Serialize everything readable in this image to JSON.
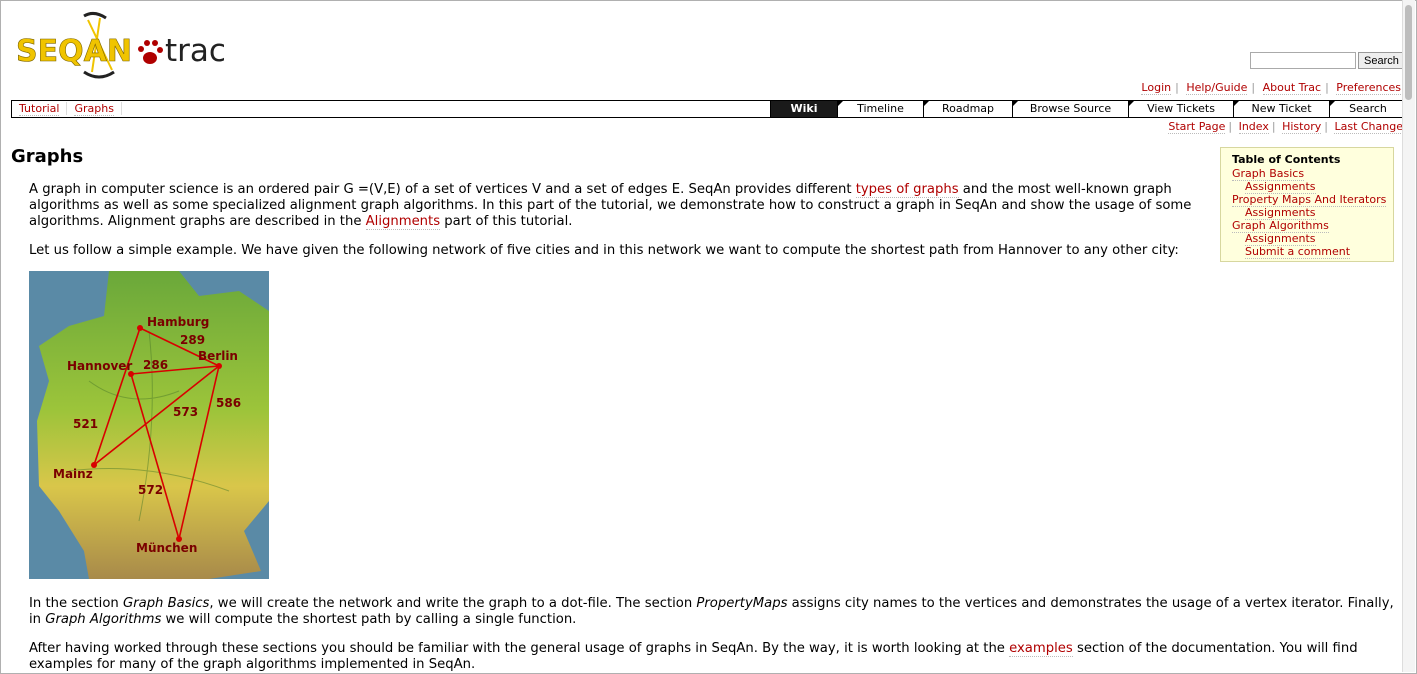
{
  "logo": {
    "left": "SEQAN",
    "right": "trac"
  },
  "search": {
    "placeholder": "",
    "button_label": "Search"
  },
  "metanav": [
    "Login",
    "Help/Guide",
    "About Trac",
    "Preferences"
  ],
  "breadcrumb": [
    "Tutorial",
    "Graphs"
  ],
  "mainnav": [
    {
      "label": "Wiki",
      "active": true
    },
    {
      "label": "Timeline"
    },
    {
      "label": "Roadmap"
    },
    {
      "label": "Browse Source"
    },
    {
      "label": "View Tickets"
    },
    {
      "label": "New Ticket"
    },
    {
      "label": "Search"
    }
  ],
  "ctxtnav": [
    "Start Page",
    "Index",
    "History",
    "Last Change"
  ],
  "page": {
    "title": "Graphs",
    "intro": {
      "p1": "A graph in computer science is an ordered pair G =(V,E) of a set of vertices V and a set of edges E. SeqAn provides different ",
      "link1": "types of graphs",
      "p2": " and the most well-known graph algorithms as well as some specialized alignment graph algorithms. In this part of the tutorial, we demonstrate how to construct a graph in SeqAn and show the usage of some algorithms. Alignment graphs are described in the ",
      "link2": "Alignments",
      "p3": " part of this tutorial."
    },
    "follow": "Let us follow a simple example. We have given the following network of five cities and in this network we want to compute the shortest path from Hannover to any other city:",
    "sections": {
      "s1": "In the section ",
      "e1": "Graph Basics",
      "s2": ", we will create the network and write the graph to a dot-file. The section ",
      "e2": "PropertyMaps",
      "s3": " assigns city names to the vertices and demonstrates the usage of a vertex iterator. Finally, in ",
      "e3": "Graph Algorithms",
      "s4": " we will compute the shortest path by calling a single function."
    },
    "after": {
      "a1": "After having worked through these sections you should be familiar with the general usage of graphs in SeqAn. By the way, it is worth looking at the ",
      "link": "examples",
      "a2": " section of the documentation. You will find examples for many of the graph algorithms implemented in SeqAn."
    }
  },
  "map": {
    "cities": [
      "Hamburg",
      "Berlin",
      "Hannover",
      "Mainz",
      "München"
    ],
    "edge_labels": [
      "289",
      "286",
      "586",
      "573",
      "521",
      "572"
    ]
  },
  "toc": {
    "title": "Table of Contents",
    "items": [
      {
        "label": "Graph Basics",
        "level": 1
      },
      {
        "label": "Assignments",
        "level": 2
      },
      {
        "label": "Property Maps And Iterators",
        "level": 1
      },
      {
        "label": "Assignments",
        "level": 2
      },
      {
        "label": "Graph Algorithms",
        "level": 1
      },
      {
        "label": "Assignments",
        "level": 2
      },
      {
        "label": "Submit a comment",
        "level": 2
      }
    ]
  },
  "colors": {
    "link": "#b00000",
    "toc_bg": "#ffffdd",
    "active_tab": "#1a1a1a"
  }
}
